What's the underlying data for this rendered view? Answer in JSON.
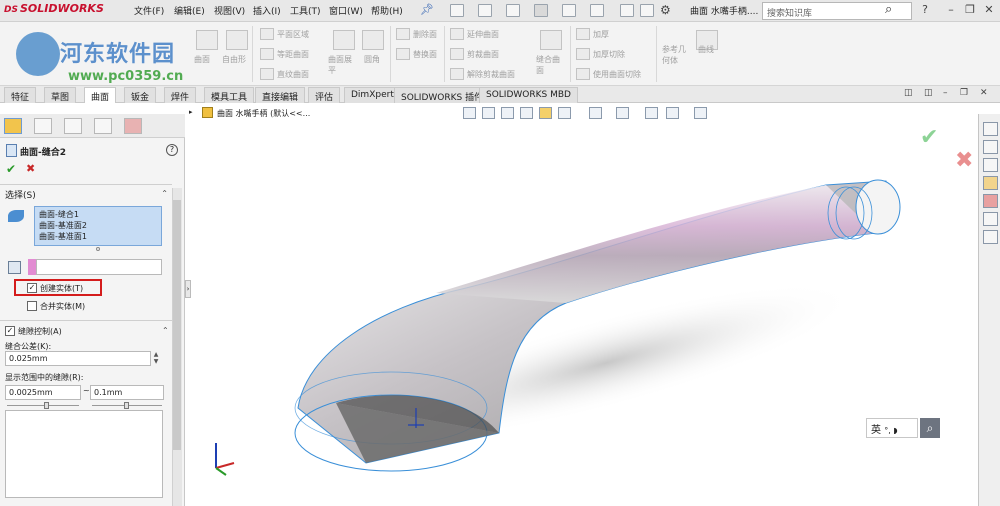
{
  "app": {
    "logo": "SOLIDWORKS",
    "logo_prefix": "DS",
    "document_title": "曲面 水嘴手柄....",
    "search_placeholder": "搜索知识库"
  },
  "menu": {
    "items": [
      "文件(F)",
      "编辑(E)",
      "视图(V)",
      "插入(I)",
      "工具(T)",
      "窗口(W)",
      "帮助(H)"
    ]
  },
  "watermark": {
    "site_name": "河东软件园",
    "url": "www.pc0359.cn"
  },
  "ribbon": {
    "items": [
      "曲面",
      "自由形",
      "平面区域",
      "等距曲面",
      "直纹曲面",
      "曲面展平",
      "圆角",
      "删除面",
      "替换面",
      "延伸曲面",
      "剪裁曲面",
      "解除剪裁曲面",
      "缝合曲面",
      "加厚",
      "加厚切除",
      "使用曲面切除",
      "参考几何体",
      "曲线"
    ]
  },
  "tabs": [
    "特征",
    "草图",
    "曲面",
    "钣金",
    "焊件",
    "模具工具",
    "直接编辑",
    "评估",
    "DimXpert",
    "SOLIDWORKS 插件",
    "SOLIDWORKS MBD"
  ],
  "active_tab": "曲面",
  "property_manager": {
    "title": "曲面-缝合2",
    "help": "?",
    "ok": "✔",
    "cancel": "✖",
    "selection": {
      "header": "选择(S)",
      "items": [
        "曲面-缝合1",
        "曲面-基准面2",
        "曲面-基准面1"
      ]
    },
    "create_solid": {
      "label": "创建实体(T)",
      "checked": true
    },
    "merge_entities": {
      "label": "合并实体(M)",
      "checked": false
    },
    "gap_control": {
      "label": "缝隙控制(A)",
      "checked": true,
      "tolerance_label": "缝合公差(K):",
      "tolerance_value": "0.025mm",
      "range_label": "显示范围中的缝隙(R):",
      "range_min": "0.0025mm",
      "range_sep": "~",
      "range_max": "0.1mm"
    }
  },
  "tree": {
    "root_label": "曲面 水嘴手柄 (默认<<..."
  },
  "ime": {
    "label": "英",
    "marks": "°, ◗"
  },
  "colors": {
    "accent_blue": "#2a5db0",
    "selection_bg": "#c6dcf4",
    "highlight_red": "#d41c1c",
    "model_edge": "#3a8fd8",
    "model_pink": "#d9a6d8"
  },
  "icons": [
    "search-icon",
    "help-icon",
    "pin-icon",
    "home-icon",
    "gear-icon",
    "folder-icon",
    "palette-icon"
  ]
}
